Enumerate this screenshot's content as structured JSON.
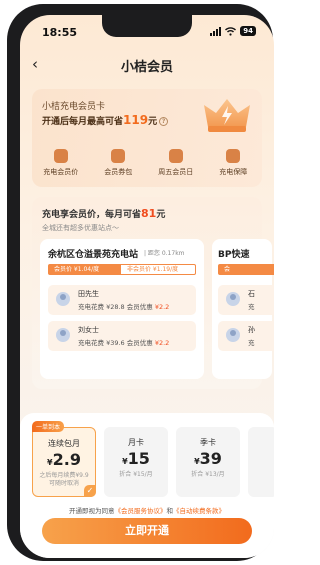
{
  "status": {
    "time": "18:55",
    "battery": "94"
  },
  "nav": {
    "back": "‹",
    "title": "小桔会员"
  },
  "membership": {
    "title": "小桔充电会员卡",
    "subtitle_pre": "开通后每月最高可省",
    "subtitle_amount": "119",
    "subtitle_post": "元",
    "help": "?",
    "benefits": [
      {
        "label": "充电会员价",
        "icon": "bolt-icon"
      },
      {
        "label": "会员券包",
        "icon": "coupon-icon"
      },
      {
        "label": "周五会员日",
        "icon": "calendar-icon"
      },
      {
        "label": "充电保障",
        "icon": "shield-icon"
      }
    ]
  },
  "stations": {
    "title_pre": "充电享会员价，每月可省",
    "title_amount": "81",
    "title_post": "元",
    "subtitle": "全城还有超多优惠站点～",
    "list": [
      {
        "name": "余杭区仓溢景苑充电站",
        "distance": "| 距您 0.17km",
        "member_price": "会员价 ¥1.04/度",
        "normal_price": "非会员价 ¥1.19/度",
        "users": [
          {
            "name": "田先生",
            "spend_label": "充电花费",
            "spend": "¥28.8",
            "discount_label": "会员优惠",
            "discount": "¥2.2"
          },
          {
            "name": "刘女士",
            "spend_label": "充电花费",
            "spend": "¥39.6",
            "discount_label": "会员优惠",
            "discount": "¥2.2"
          }
        ]
      },
      {
        "name": "BP快速",
        "member_price": "会",
        "users": [
          {
            "name": "石",
            "spend_label": "充"
          },
          {
            "name": "孙",
            "spend_label": "充"
          }
        ]
      }
    ]
  },
  "plans": [
    {
      "tag": "一单到本",
      "name": "连续包月",
      "currency": "¥",
      "price": "2.9",
      "desc1": "之后每月续费¥9.9",
      "desc2": "可随时取消",
      "selected": true
    },
    {
      "name": "月卡",
      "currency": "¥",
      "price": "15",
      "desc1": "折合 ¥15/月"
    },
    {
      "name": "季卡",
      "currency": "¥",
      "price": "39",
      "desc1": "折合 ¥13/月"
    }
  ],
  "agreement": {
    "pre": "开通即视为同意",
    "link1": "《会员服务协议》",
    "mid": "和",
    "link2": "《自动续费条款》"
  },
  "cta": {
    "label": "立即开通"
  },
  "colors": {
    "accent": "#f26b1d",
    "accent_light": "#f7a24b",
    "red": "#f04d1f"
  }
}
